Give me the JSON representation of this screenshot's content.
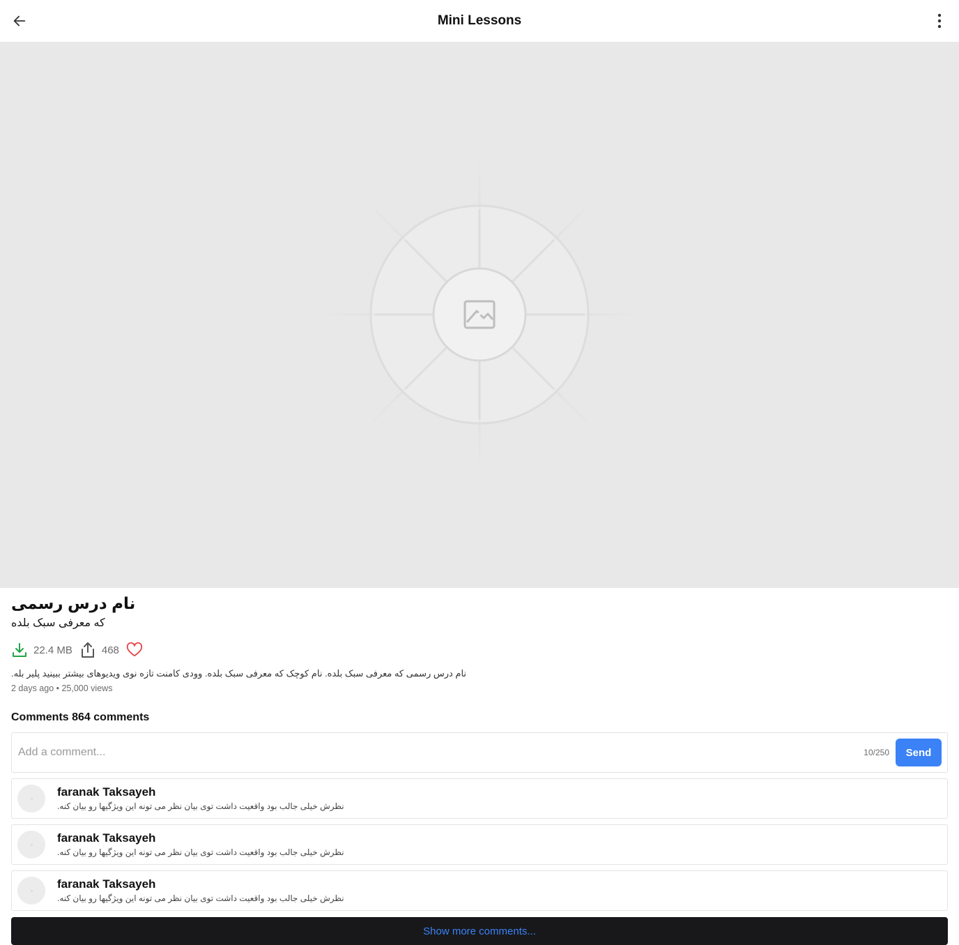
{
  "header": {
    "title": "Mini Lessons",
    "back_icon": "arrow-left-icon",
    "menu_icon": "more-vertical-icon"
  },
  "media": {
    "placeholder_icon": "image-broken-icon"
  },
  "lesson": {
    "title": "نام درس رسمی",
    "subtitle": "که معرفی سبک بلده",
    "size": "22.4 MB",
    "shares": "468",
    "description": "نام درس رسمی که معرفی سبک بلده. نام کوچک که معرفی سبک بلده. وودی کامنت تازه نوی ویدیوهای بیشتر ببینید پلیر بله.",
    "meta": "2 days ago • 25,000 views"
  },
  "colors": {
    "download": "#22a447",
    "heart": "#e5484d",
    "accent": "#3b82f6"
  },
  "comments": {
    "heading": "Comments 864 comments",
    "input_placeholder": "Add a comment...",
    "counter": "10/250",
    "send_label": "Send",
    "items": [
      {
        "name": "faranak Taksayeh",
        "text": "نظرش خیلی جالب بود واقعیت داشت توی بیان نظر می تونه این ویژگیها رو بیان کنه."
      },
      {
        "name": "faranak Taksayeh",
        "text": "نظرش خیلی جالب بود واقعیت داشت توی بیان نظر می تونه این ویژگیها رو بیان کنه."
      },
      {
        "name": "faranak Taksayeh",
        "text": "نظرش خیلی جالب بود واقعیت داشت توی بیان نظر می تونه این ویژگیها رو بیان کنه."
      }
    ],
    "show_more_label": "Show more comments..."
  }
}
